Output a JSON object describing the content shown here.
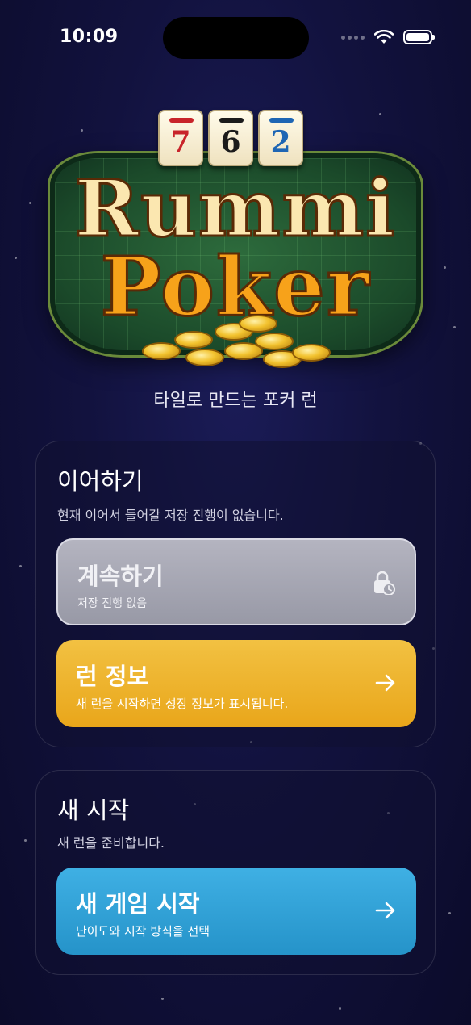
{
  "status_bar": {
    "time": "10:09"
  },
  "logo": {
    "tiles": [
      {
        "number": "7",
        "color": "#c8242a"
      },
      {
        "number": "6",
        "color": "#1b1b1b"
      },
      {
        "number": "2",
        "color": "#1e66b4"
      }
    ],
    "word1": "Rummi",
    "word2": "Poker"
  },
  "tagline": "타일로 만드는 포커 런",
  "continue_section": {
    "title": "이어하기",
    "subtitle": "현재 이어서 들어갈 저장 진행이 없습니다.",
    "continue_button": {
      "label": "계속하기",
      "sub": "저장 진행 없음",
      "icon": "lock-clock-icon",
      "enabled": false
    },
    "run_info_button": {
      "label": "런 정보",
      "sub": "새 런을 시작하면 성장 정보가 표시됩니다.",
      "icon": "arrow-right-icon"
    }
  },
  "new_section": {
    "title": "새 시작",
    "subtitle": "새 런을 준비합니다.",
    "new_game_button": {
      "label": "새 게임 시작",
      "sub": "난이도와 시작 방식을 선택",
      "icon": "arrow-right-icon"
    }
  },
  "colors": {
    "background": "#12123e",
    "continue_disabled": "#a9a9b6",
    "run_info": "#eeb22e",
    "new_game": "#33a4d8"
  }
}
